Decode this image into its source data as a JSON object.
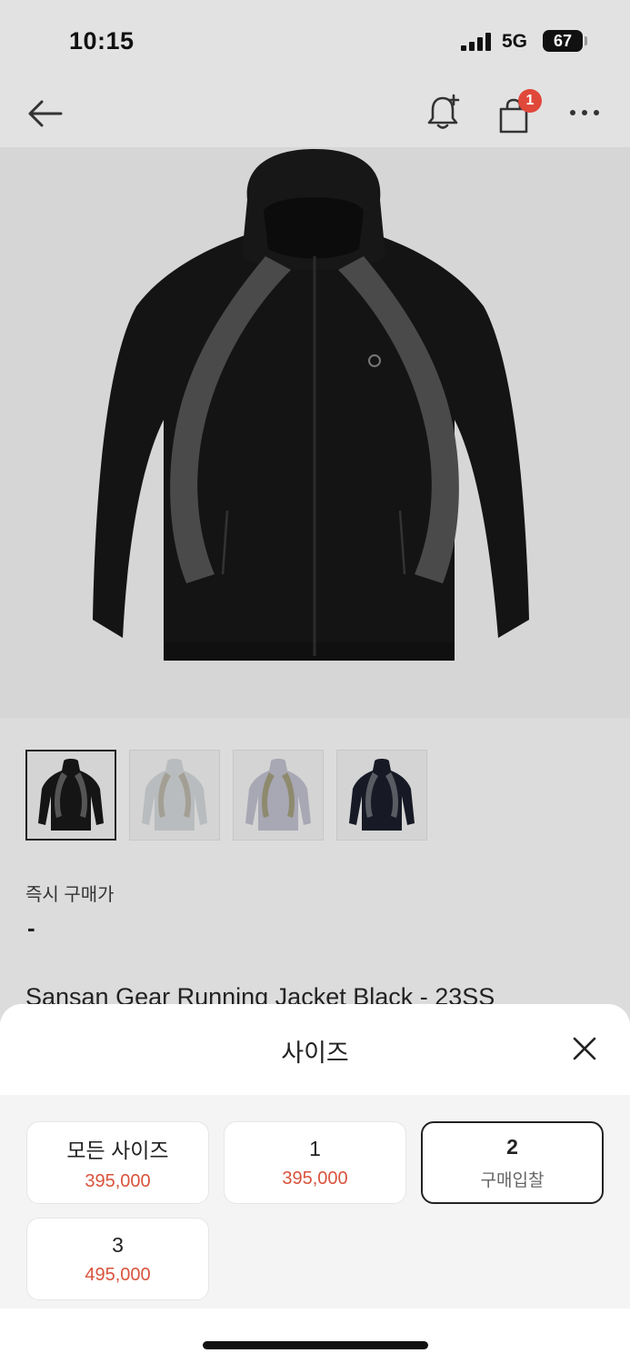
{
  "status_bar": {
    "time": "10:15",
    "network": "5G",
    "battery": "67"
  },
  "nav": {
    "cart_badge": "1",
    "icons": [
      "back-arrow-icon",
      "bell-plus-icon",
      "shopping-bag-icon",
      "more-icon"
    ]
  },
  "product": {
    "price_label": "즉시 구매가",
    "price_value": "-",
    "title": "Sansan Gear Running Jacket Black - 23SS",
    "thumbnail_count": 4
  },
  "sheet": {
    "title": "사이즈",
    "options": [
      {
        "name": "모든 사이즈",
        "price": "395,000"
      },
      {
        "name": "1",
        "price": "395,000"
      },
      {
        "name": "2",
        "price": "구매입찰"
      },
      {
        "name": "3",
        "price": "495,000"
      }
    ]
  },
  "colors": {
    "accent_price": "#d9533c",
    "badge": "#e0483a",
    "background": "#dcdcdc"
  }
}
